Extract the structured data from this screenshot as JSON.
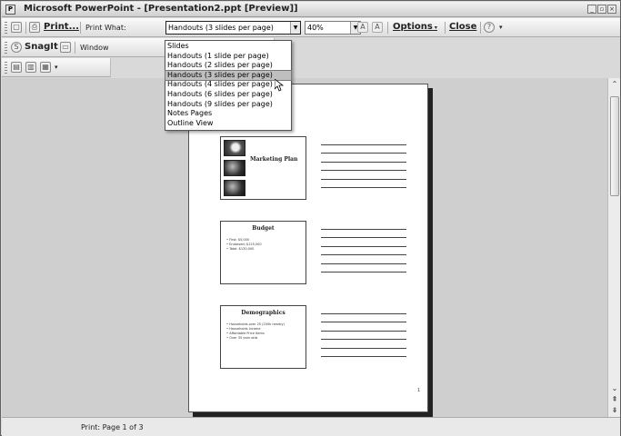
{
  "window": {
    "app_icon": "powerpoint-icon",
    "title": "Microsoft PowerPoint - [Presentation2.ppt [Preview]]",
    "controls": [
      "minimize-icon",
      "restore-icon",
      "close-icon"
    ]
  },
  "preview_toolbar": {
    "print_label": "Print...",
    "print_what_label": "Print What:",
    "print_what_value": "Handouts (3 slides per page)",
    "zoom_value": "40%",
    "options_label": "Options",
    "close_label": "Close"
  },
  "snagit_toolbar": {
    "snagit_label": "SnagIt",
    "capture_mode": "Window"
  },
  "print_what_options": [
    "Slides",
    "Handouts (1 slide per page)",
    "Handouts (2 slides per page)",
    "Handouts (3 slides per page)",
    "Handouts (4 slides per page)",
    "Handouts (6 slides per page)",
    "Handouts (9 slides per page)",
    "Notes Pages",
    "Outline View"
  ],
  "selected_option_index": 3,
  "handout_page": {
    "slides": [
      {
        "title": "Marketing Plan"
      },
      {
        "title": "Budget",
        "bullets": [
          "First: $5,000",
          "Endorsed: $125,000",
          "Total: $130,000"
        ]
      },
      {
        "title": "Demographics",
        "bullets": [
          "Households over 25 (200k nearby)",
          "Households Income",
          "Affordable Price Items",
          "Over 35 year olds"
        ]
      }
    ],
    "page_number": "1"
  },
  "status_bar": {
    "text": "Print: Page 1 of 3"
  }
}
